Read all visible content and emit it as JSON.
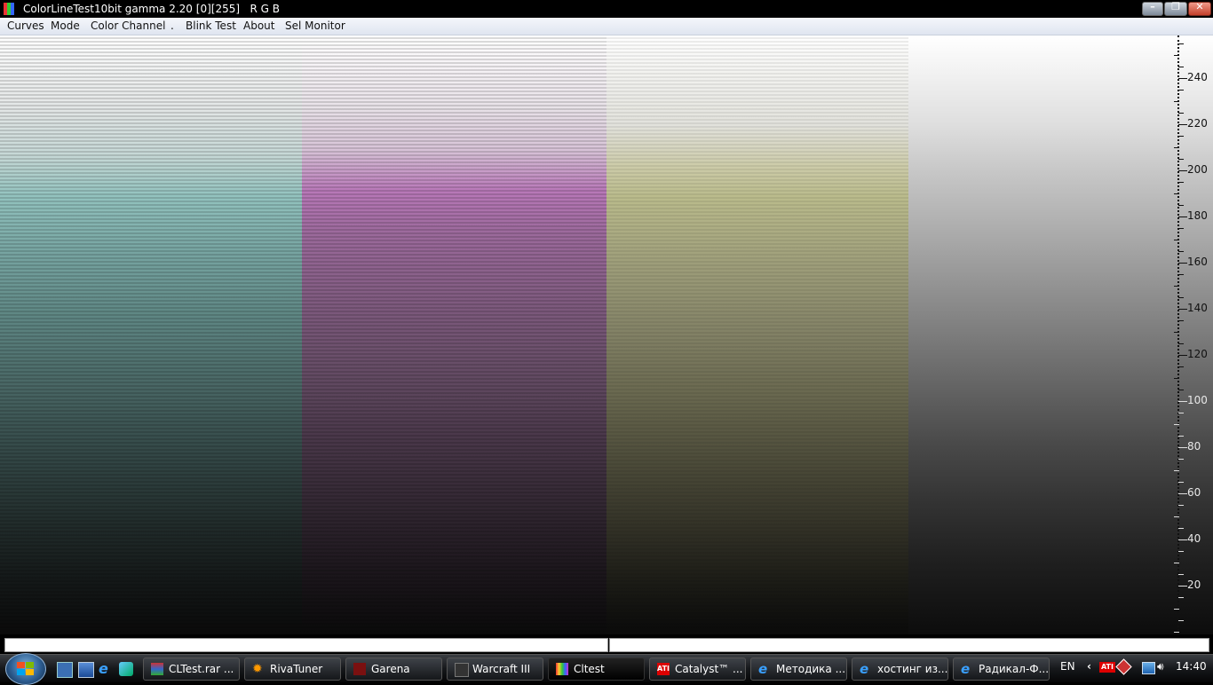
{
  "window": {
    "title": "ColorLineTest10bit gamma 2.20 [0][255]   R G B",
    "controls": {
      "minimize": "minimize",
      "maximize": "restore",
      "close": "close"
    }
  },
  "menu": {
    "items": [
      "Curves",
      "Mode",
      "Color Channel",
      ".",
      "Blink Test",
      "About",
      "Sel Monitor"
    ]
  },
  "test_pattern": {
    "bands": [
      {
        "name": "cyan",
        "color_mid": "#7aa8a5"
      },
      {
        "name": "magenta",
        "color_mid": "#9c6a9c"
      },
      {
        "name": "yellow",
        "color_mid": "#a1a17c"
      },
      {
        "name": "gray",
        "color_mid": "#959595"
      }
    ],
    "scale": {
      "range": [
        0,
        255
      ],
      "labels": [
        "240",
        "220",
        "200",
        "180",
        "160",
        "140",
        "120",
        "100",
        "80",
        "60",
        "40",
        "20"
      ]
    }
  },
  "taskbar": {
    "quick_launch": [
      "show-desktop",
      "switch-windows",
      "internet-explorer",
      "media-app"
    ],
    "buttons": [
      {
        "label": "CLTest.rar ...",
        "icon": "winrar-icon",
        "active": false
      },
      {
        "label": "RivaTuner",
        "icon": "rivatuner-icon",
        "active": false
      },
      {
        "label": "Garena",
        "icon": "garena-icon",
        "active": false
      },
      {
        "label": "Warcraft III",
        "icon": "warcraft-icon",
        "active": false
      },
      {
        "label": "Cltest",
        "icon": "cltest-icon",
        "active": true
      },
      {
        "label": "Catalyst™ ...",
        "icon": "ati-icon",
        "active": false
      },
      {
        "label": "Методика ...",
        "icon": "ie-icon",
        "active": false
      },
      {
        "label": "хостинг из...",
        "icon": "ie-icon",
        "active": false
      },
      {
        "label": "Радикал-Ф...",
        "icon": "ie-icon",
        "active": false
      }
    ],
    "tray": {
      "language": "EN",
      "clock": "14:40"
    }
  }
}
